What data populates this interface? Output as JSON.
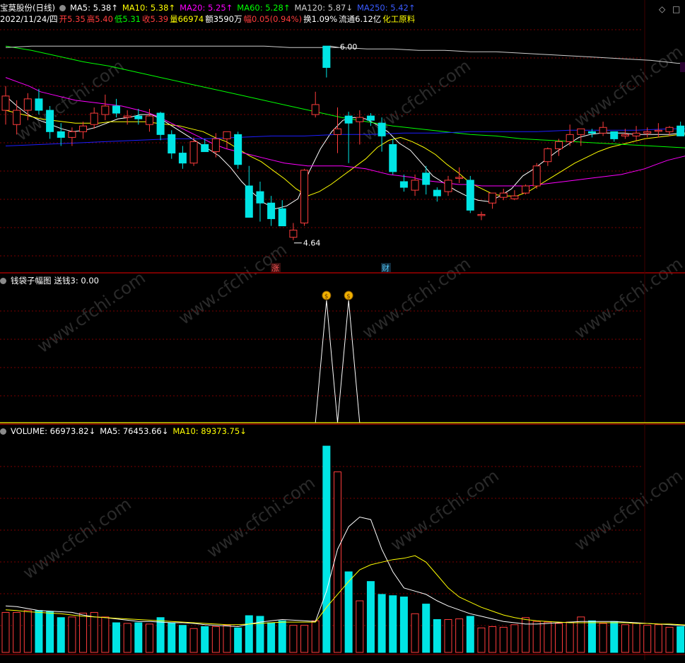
{
  "price_header": {
    "stock_name": "宝莫股份(日线)",
    "ma5": "MA5: 5.38↑",
    "ma10": "MA10: 5.38↑",
    "ma20": "MA20: 5.25↑",
    "ma60": "MA60: 5.28↑",
    "ma120": "MA120: 5.87↓",
    "ma250": "MA250: 5.42↑"
  },
  "quote_line": {
    "date": "2022/11/24/四",
    "open": "开5.35",
    "high": "高5.40",
    "low": "低5.31",
    "close": "收5.39",
    "volume": "量66974",
    "amount": "额3590万",
    "change": "幅0.05(0.94%)",
    "turnover": "换1.09%",
    "float": "流通6.12亿",
    "sector": "化工原料"
  },
  "markers": {
    "high_price": "6.00",
    "low_price": "4.64",
    "zhang": "涨",
    "cai": "财"
  },
  "indicator_header": {
    "name": "钱袋子幅图",
    "value": "送钱3: 0.00"
  },
  "volume_header": {
    "volume": "VOLUME: 66973.82↓",
    "ma5": "MA5: 76453.66↓",
    "ma10": "MA10: 89373.75↓"
  },
  "watermark": "www.cfchi.com",
  "colors": {
    "up": "#ff3c3c",
    "down": "#00e5e5",
    "ma5": "#ffffff",
    "ma10": "#ffff00",
    "ma20": "#ff00ff",
    "ma60": "#00ff00",
    "ma120": "#cccccc",
    "ma250": "#1e1eff",
    "grid": "#7a0000"
  },
  "chart_data": {
    "type": "candlestick",
    "price_ylim": [
      4.5,
      6.1
    ],
    "candles": [
      {
        "o": 5.55,
        "h": 5.72,
        "l": 5.45,
        "c": 5.65
      },
      {
        "o": 5.45,
        "h": 5.62,
        "l": 5.38,
        "c": 5.55
      },
      {
        "o": 5.55,
        "h": 5.67,
        "l": 5.48,
        "c": 5.63
      },
      {
        "o": 5.63,
        "h": 5.7,
        "l": 5.52,
        "c": 5.55
      },
      {
        "o": 5.55,
        "h": 5.58,
        "l": 5.35,
        "c": 5.4
      },
      {
        "o": 5.4,
        "h": 5.46,
        "l": 5.3,
        "c": 5.36
      },
      {
        "o": 5.36,
        "h": 5.43,
        "l": 5.3,
        "c": 5.4
      },
      {
        "o": 5.4,
        "h": 5.47,
        "l": 5.35,
        "c": 5.44
      },
      {
        "o": 5.45,
        "h": 5.57,
        "l": 5.42,
        "c": 5.53
      },
      {
        "o": 5.52,
        "h": 5.66,
        "l": 5.48,
        "c": 5.58
      },
      {
        "o": 5.58,
        "h": 5.63,
        "l": 5.5,
        "c": 5.53
      },
      {
        "o": 5.5,
        "h": 5.55,
        "l": 5.45,
        "c": 5.51
      },
      {
        "o": 5.51,
        "h": 5.56,
        "l": 5.45,
        "c": 5.49
      },
      {
        "o": 5.45,
        "h": 5.56,
        "l": 5.4,
        "c": 5.51
      },
      {
        "o": 5.53,
        "h": 5.54,
        "l": 5.34,
        "c": 5.38
      },
      {
        "o": 5.38,
        "h": 5.41,
        "l": 5.21,
        "c": 5.25
      },
      {
        "o": 5.25,
        "h": 5.3,
        "l": 5.14,
        "c": 5.18
      },
      {
        "o": 5.18,
        "h": 5.36,
        "l": 5.16,
        "c": 5.33
      },
      {
        "o": 5.31,
        "h": 5.35,
        "l": 5.26,
        "c": 5.26
      },
      {
        "o": 5.26,
        "h": 5.39,
        "l": 5.22,
        "c": 5.35
      },
      {
        "o": 5.35,
        "h": 5.4,
        "l": 5.28,
        "c": 5.4
      },
      {
        "o": 5.38,
        "h": 5.4,
        "l": 5.14,
        "c": 5.17
      },
      {
        "o": 5.02,
        "h": 5.16,
        "l": 4.8,
        "c": 4.8
      },
      {
        "o": 4.98,
        "h": 5.05,
        "l": 4.77,
        "c": 4.9
      },
      {
        "o": 4.9,
        "h": 4.95,
        "l": 4.74,
        "c": 4.79
      },
      {
        "o": 4.86,
        "h": 4.92,
        "l": 4.74,
        "c": 4.74
      },
      {
        "o": 4.66,
        "h": 4.76,
        "l": 4.64,
        "c": 4.71
      },
      {
        "o": 4.76,
        "h": 5.14,
        "l": 4.74,
        "c": 5.13
      },
      {
        "o": 5.52,
        "h": 5.68,
        "l": 5.5,
        "c": 5.59
      },
      {
        "o": 6.0,
        "h": 6.0,
        "l": 5.78,
        "c": 5.85
      },
      {
        "o": 5.38,
        "h": 5.57,
        "l": 5.25,
        "c": 5.42
      },
      {
        "o": 5.51,
        "h": 5.54,
        "l": 5.18,
        "c": 5.46
      },
      {
        "o": 5.47,
        "h": 5.55,
        "l": 5.31,
        "c": 5.5
      },
      {
        "o": 5.51,
        "h": 5.53,
        "l": 5.44,
        "c": 5.48
      },
      {
        "o": 5.46,
        "h": 5.5,
        "l": 5.26,
        "c": 5.37
      },
      {
        "o": 5.31,
        "h": 5.35,
        "l": 5.1,
        "c": 5.12
      },
      {
        "o": 5.05,
        "h": 5.1,
        "l": 4.98,
        "c": 5.01
      },
      {
        "o": 4.99,
        "h": 5.1,
        "l": 4.95,
        "c": 5.06
      },
      {
        "o": 5.11,
        "h": 5.16,
        "l": 4.96,
        "c": 5.03
      },
      {
        "o": 4.99,
        "h": 5.01,
        "l": 4.91,
        "c": 4.95
      },
      {
        "o": 4.98,
        "h": 5.09,
        "l": 4.95,
        "c": 5.06
      },
      {
        "o": 5.08,
        "h": 5.15,
        "l": 5.04,
        "c": 5.08
      },
      {
        "o": 5.06,
        "h": 5.09,
        "l": 4.83,
        "c": 4.85
      },
      {
        "o": 4.82,
        "h": 4.84,
        "l": 4.78,
        "c": 4.82
      },
      {
        "o": 4.9,
        "h": 4.95,
        "l": 4.86,
        "c": 4.97
      },
      {
        "o": 4.94,
        "h": 5.0,
        "l": 4.92,
        "c": 4.97
      },
      {
        "o": 4.93,
        "h": 4.99,
        "l": 4.92,
        "c": 4.95
      },
      {
        "o": 4.97,
        "h": 5.03,
        "l": 4.96,
        "c": 5.02
      },
      {
        "o": 5.02,
        "h": 5.18,
        "l": 5.0,
        "c": 5.16
      },
      {
        "o": 5.19,
        "h": 5.29,
        "l": 5.16,
        "c": 5.28
      },
      {
        "o": 5.28,
        "h": 5.35,
        "l": 5.23,
        "c": 5.33
      },
      {
        "o": 5.33,
        "h": 5.45,
        "l": 5.3,
        "c": 5.38
      },
      {
        "o": 5.38,
        "h": 5.41,
        "l": 5.3,
        "c": 5.42
      },
      {
        "o": 5.4,
        "h": 5.42,
        "l": 5.36,
        "c": 5.39
      },
      {
        "o": 5.39,
        "h": 5.47,
        "l": 5.37,
        "c": 5.43
      },
      {
        "o": 5.4,
        "h": 5.4,
        "l": 5.33,
        "c": 5.35
      },
      {
        "o": 5.37,
        "h": 5.42,
        "l": 5.35,
        "c": 5.38
      },
      {
        "o": 5.37,
        "h": 5.44,
        "l": 5.34,
        "c": 5.39
      },
      {
        "o": 5.39,
        "h": 5.43,
        "l": 5.36,
        "c": 5.4
      },
      {
        "o": 5.41,
        "h": 5.46,
        "l": 5.36,
        "c": 5.41
      },
      {
        "o": 5.4,
        "h": 5.44,
        "l": 5.37,
        "c": 5.43
      },
      {
        "o": 5.44,
        "h": 5.47,
        "l": 5.39,
        "c": 5.37
      },
      {
        "o": 5.36,
        "h": 5.4,
        "l": 5.33,
        "c": 5.36
      },
      {
        "o": 5.35,
        "h": 5.4,
        "l": 5.31,
        "c": 5.39
      }
    ],
    "ma_lines": [
      {
        "name": "MA5",
        "values": [
          5.65,
          5.58,
          5.52,
          5.48,
          5.45,
          5.42,
          5.4,
          5.41,
          5.43,
          5.46,
          5.49,
          5.5,
          5.52,
          5.52,
          5.48,
          5.43,
          5.38,
          5.33,
          5.28,
          5.23,
          5.15,
          5.05,
          4.97,
          4.9,
          4.86,
          4.88,
          4.93,
          5.12,
          5.28,
          5.4,
          5.48,
          5.5,
          5.49,
          5.45,
          5.4,
          5.32,
          5.27,
          5.18,
          5.09,
          5.04,
          4.99,
          4.95,
          4.92,
          4.91,
          4.95,
          5.0,
          5.09,
          5.14,
          5.2,
          5.26,
          5.31,
          5.36,
          5.38,
          5.39,
          5.39,
          5.39,
          5.38,
          5.38,
          5.38,
          5.38,
          5.39,
          5.39,
          5.38
        ]
      },
      {
        "name": "MA10",
        "values": [
          5.55,
          5.53,
          5.51,
          5.49,
          5.48,
          5.47,
          5.46,
          5.46,
          5.46,
          5.47,
          5.47,
          5.47,
          5.47,
          5.46,
          5.45,
          5.44,
          5.42,
          5.4,
          5.36,
          5.33,
          5.28,
          5.23,
          5.19,
          5.13,
          5.07,
          5.0,
          4.95,
          4.98,
          5.03,
          5.09,
          5.15,
          5.21,
          5.29,
          5.34,
          5.36,
          5.33,
          5.29,
          5.24,
          5.17,
          5.11,
          5.04,
          5.0,
          4.96,
          4.95,
          4.95,
          4.98,
          5.03,
          5.08,
          5.13,
          5.18,
          5.22,
          5.26,
          5.29,
          5.31,
          5.33,
          5.35,
          5.36,
          5.37,
          5.38,
          5.38,
          5.39
        ]
      },
      {
        "name": "MA20",
        "values": [
          5.78,
          5.75,
          5.72,
          5.68,
          5.66,
          5.64,
          5.62,
          5.61,
          5.6,
          5.59,
          5.58,
          5.56,
          5.54,
          5.51,
          5.47,
          5.43,
          5.39,
          5.35,
          5.31,
          5.28,
          5.26,
          5.24,
          5.22,
          5.2,
          5.18,
          5.17,
          5.16,
          5.16,
          5.16,
          5.16,
          5.15,
          5.14,
          5.12,
          5.1,
          5.09,
          5.08,
          5.06,
          5.05,
          5.04,
          5.03,
          5.03,
          5.02,
          5.02,
          5.02,
          5.02,
          5.02,
          5.03,
          5.04,
          5.05,
          5.06,
          5.07,
          5.08,
          5.09,
          5.1,
          5.12,
          5.14,
          5.17,
          5.2,
          5.22,
          5.24,
          5.25
        ]
      },
      {
        "name": "MA60",
        "values": [
          6.0,
          5.97,
          5.93,
          5.89,
          5.86,
          5.82,
          5.78,
          5.74,
          5.7,
          5.66,
          5.62,
          5.58,
          5.54,
          5.5,
          5.47,
          5.44,
          5.42,
          5.4,
          5.38,
          5.37,
          5.35,
          5.34,
          5.33,
          5.32,
          5.31,
          5.3,
          5.29,
          5.28
        ]
      },
      {
        "name": "MA120",
        "values": [
          5.99,
          6.0,
          6.0,
          6.0,
          6.0,
          6.0,
          6.0,
          6.0,
          6.0,
          6.0,
          6.0,
          5.99,
          5.99,
          5.99,
          5.98,
          5.98,
          5.97,
          5.97,
          5.96,
          5.96,
          5.95,
          5.94,
          5.93,
          5.92,
          5.91,
          5.9,
          5.88,
          5.87
        ]
      },
      {
        "name": "MA250",
        "values": [
          5.3,
          5.31,
          5.32,
          5.33,
          5.34,
          5.35,
          5.35,
          5.36,
          5.37,
          5.37,
          5.38,
          5.38,
          5.39,
          5.39,
          5.4,
          5.4,
          5.4,
          5.41,
          5.41,
          5.41,
          5.42,
          5.42
        ]
      }
    ],
    "signal": {
      "name": "送钱3",
      "values": [
        0,
        0,
        0,
        0,
        0,
        0,
        0,
        0,
        0,
        0,
        0,
        0,
        0,
        0,
        0,
        0,
        0,
        0,
        0,
        0,
        0,
        0,
        0,
        0,
        0,
        0,
        0,
        0,
        0,
        1,
        0,
        1,
        0,
        0,
        0,
        0,
        0,
        0,
        0,
        0,
        0,
        0,
        0,
        0,
        0,
        0,
        0,
        0,
        0,
        0,
        0,
        0,
        0,
        0,
        0,
        0,
        0,
        0,
        0,
        0,
        0,
        0,
        0,
        0
      ]
    },
    "volume": {
      "ylim": [
        0,
        330000
      ],
      "values": [
        62000,
        62000,
        65000,
        65000,
        63000,
        54000,
        55000,
        61000,
        62000,
        55000,
        46000,
        45000,
        46000,
        44000,
        54000,
        46000,
        42000,
        37000,
        40000,
        40000,
        42000,
        38000,
        57000,
        56000,
        46000,
        49000,
        42000,
        42000,
        49000,
        320000,
        280000,
        125000,
        80000,
        110000,
        90000,
        88000,
        86000,
        60000,
        75000,
        51000,
        51000,
        52000,
        56000,
        38000,
        40000,
        39000,
        43000,
        54000,
        48000,
        47000,
        45000,
        47000,
        55000,
        49000,
        45000,
        48000,
        43000,
        45000,
        42000,
        43000,
        39000,
        40000,
        39000,
        32000
      ],
      "ma5": [
        72000,
        71000,
        68000,
        65000,
        64000,
        63000,
        62000,
        58000,
        55000,
        54000,
        52000,
        50000,
        48000,
        48000,
        47000,
        46000,
        46000,
        45000,
        43000,
        42000,
        41000,
        40000,
        44000,
        47000,
        49000,
        51000,
        50000,
        49000,
        48000,
        95000,
        160000,
        195000,
        210000,
        206000,
        160000,
        125000,
        100000,
        95000,
        90000,
        80000,
        72000,
        66000,
        60000,
        56000,
        52000,
        48000,
        46000,
        44000,
        44000,
        45000,
        46000,
        47000,
        48000,
        48000,
        48000,
        48000,
        47000,
        46000,
        45000,
        44000,
        43000,
        42000,
        41000,
        40000
      ],
      "ma10": [
        66000,
        65000,
        63000,
        62000,
        61000,
        60000,
        58000,
        56000,
        55000,
        54000,
        53000,
        52000,
        51000,
        50000,
        49000,
        48000,
        47000,
        46000,
        45000,
        44000,
        43000,
        43000,
        44000,
        45000,
        46000,
        47000,
        47000,
        47000,
        47000,
        70000,
        90000,
        110000,
        128000,
        136000,
        140000,
        144000,
        146000,
        150000,
        140000,
        120000,
        100000,
        86000,
        78000,
        70000,
        64000,
        58000,
        54000,
        51000,
        49000,
        48000,
        47000,
        46000,
        46000,
        46000,
        46000,
        46000,
        46000,
        45000,
        45000,
        44000,
        44000,
        43000,
        42000,
        41000
      ]
    }
  }
}
